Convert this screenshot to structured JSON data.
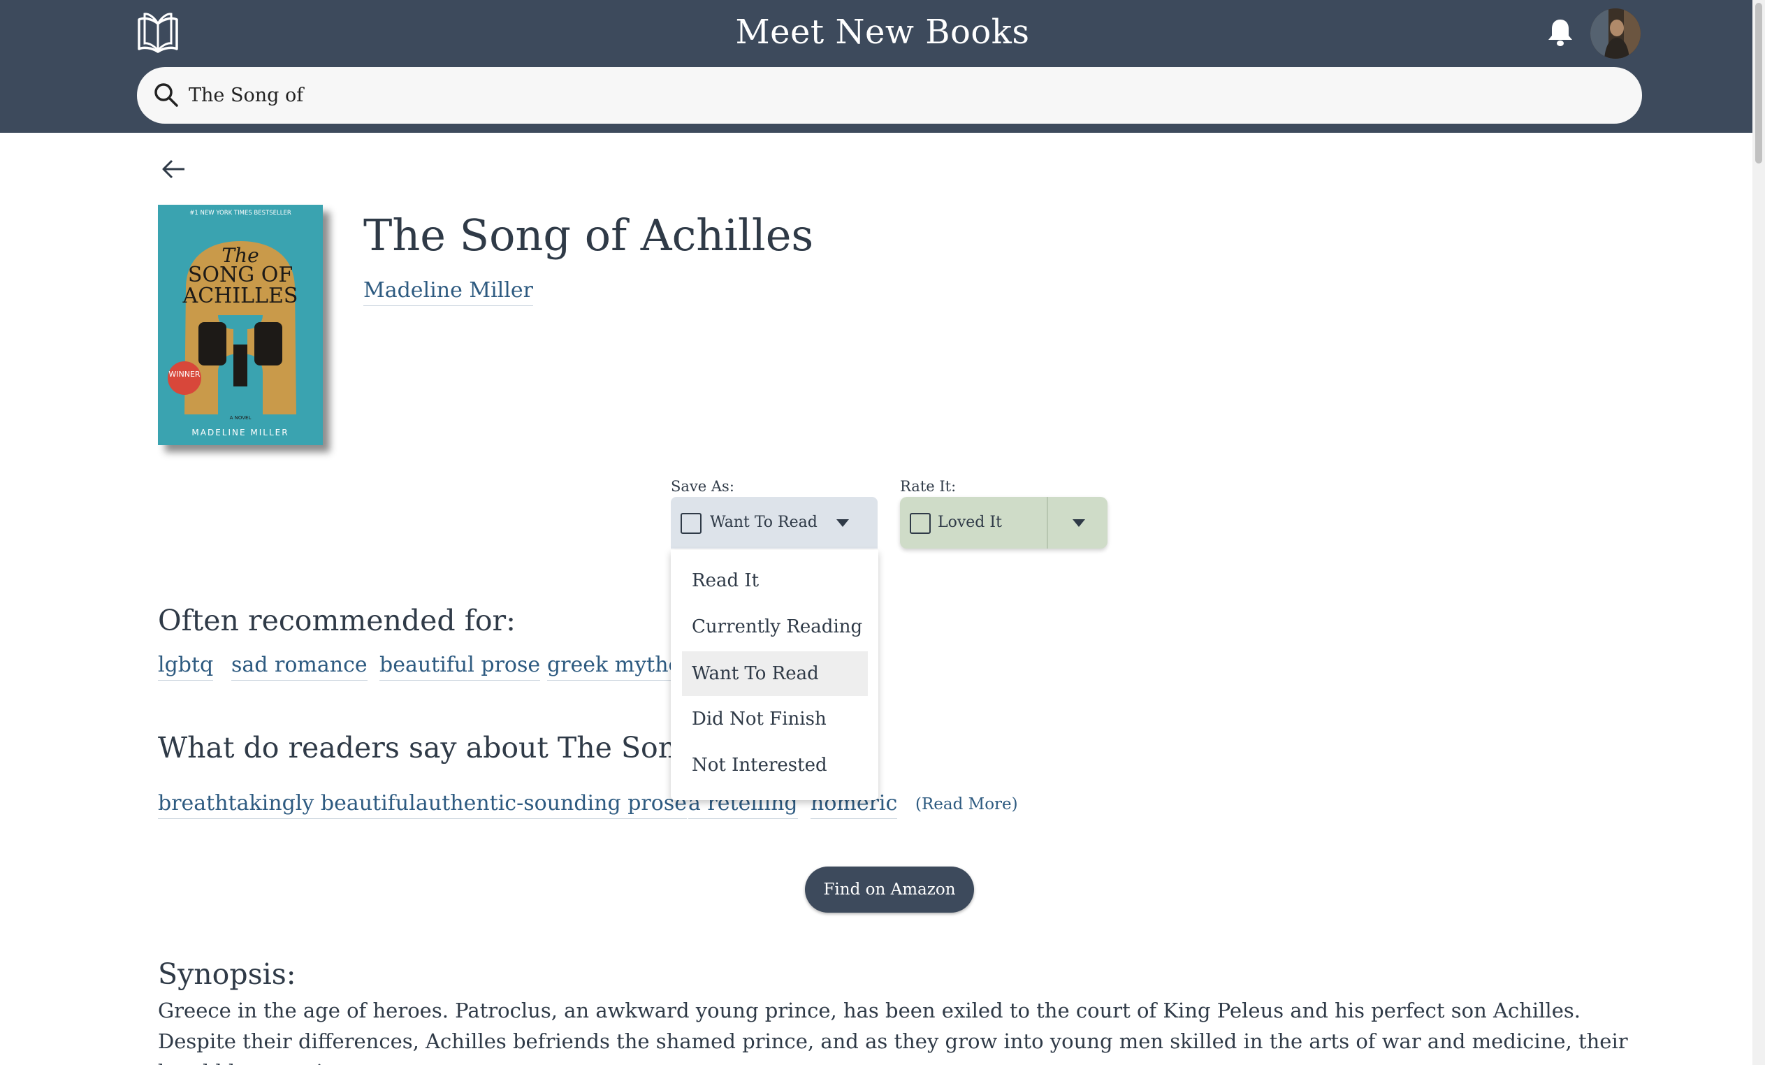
{
  "header": {
    "title": "Meet New Books",
    "logo_icon": "open-book-icon",
    "notification_icon": "bell-icon",
    "avatar_icon": "user-avatar"
  },
  "search": {
    "value": "The Song of",
    "icon": "search-icon"
  },
  "book": {
    "title": "The Song of Achilles",
    "author": "Madeline Miller",
    "cover": {
      "banner": "#1 NEW YORK TIMES BESTSELLER",
      "title_line1": "The",
      "title_line2": "SONG OF",
      "title_line3": "ACHILLES",
      "badge": "WINNER",
      "novel_label": "A NOVEL",
      "author": "MADELINE MILLER"
    }
  },
  "save_as": {
    "label": "Save As:",
    "selected": "Want To Read",
    "options": [
      "Read It",
      "Currently Reading",
      "Want To Read",
      "Did Not Finish",
      "Not Interested"
    ]
  },
  "rate_it": {
    "label": "Rate It:",
    "selected": "Loved It"
  },
  "recommended": {
    "heading": "Often recommended for:",
    "tags": [
      "lgbtq",
      "sad romance",
      "beautiful prose",
      "greek mytho"
    ]
  },
  "readers": {
    "heading": "What do readers say about The Song o",
    "tags": [
      "breathtakingly beautiful",
      "authentic-sounding prose",
      "a retelling",
      "homeric"
    ],
    "read_more": "(Read More)"
  },
  "amazon_button": "Find on Amazon",
  "synopsis": {
    "heading": "Synopsis:",
    "text": "Greece in the age of heroes. Patroclus, an awkward young prince, has been exiled to the court of King Peleus and his perfect son Achilles. Despite their differences, Achilles befriends the shamed prince, and as they grow into young men skilled in the arts of war and medicine, their bond blossoms into"
  },
  "colors": {
    "header_bg": "#3d4a5c",
    "link": "#2d5a80",
    "save_bg": "#dde3ea",
    "rate_bg": "#cfdcc8",
    "cover_teal": "#3aa3b0"
  }
}
